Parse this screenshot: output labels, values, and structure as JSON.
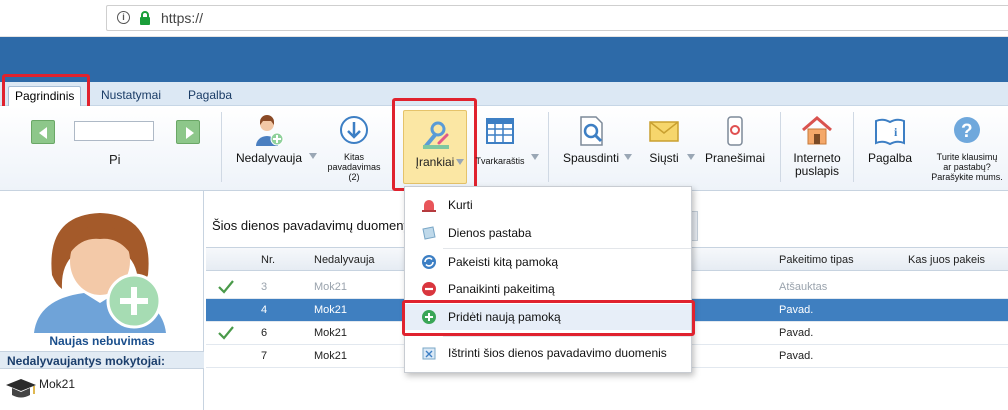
{
  "browser": {
    "url": "https://"
  },
  "tabs": [
    {
      "label": "Pagrindinis",
      "active": true
    },
    {
      "label": "Nustatymai",
      "active": false
    },
    {
      "label": "Pagalba",
      "active": false
    }
  ],
  "nav": {
    "label": "Pi"
  },
  "ribbon": {
    "nedalyvauja": "Nedalyvauja",
    "kitas_1": "Kitas",
    "kitas_2": "pavadavimas",
    "kitas_3": "(2)",
    "irankiai": "Įrankiai",
    "tvarkarastis": "Tvarkaraštis",
    "spausdinti": "Spausdinti",
    "siusti": "Siųsti",
    "pranesimai": "Pranešimai",
    "interneto_1": "Interneto",
    "interneto_2": "puslapis",
    "pagalba": "Pagalba",
    "klausimai_1": "Turite klausimų",
    "klausimai_2": "ar pastabų?",
    "klausimai_3": "Parašykite mums."
  },
  "left": {
    "new_absence": "Naujas nebuvimas",
    "absent_header": "Nedalyvaujantys mokytojai:",
    "teachers": [
      "Mok21"
    ]
  },
  "main": {
    "title": "Šios dienos pavadavimų duomeny",
    "columns": {
      "nr": "Nr.",
      "nedalyvauja": "Nedalyvauja",
      "tipas": "Pakeitimo tipas",
      "kas": "Kas juos pakeis"
    },
    "rows": [
      {
        "check": true,
        "nr": "3",
        "teacher": "Mok21",
        "type": "Atšauktas",
        "dim": true,
        "selected": false
      },
      {
        "check": false,
        "nr": "4",
        "teacher": "Mok21",
        "type": "Pavad.",
        "dim": false,
        "selected": true
      },
      {
        "check": true,
        "nr": "6",
        "teacher": "Mok21",
        "type": "Pavad.",
        "dim": false,
        "selected": false
      },
      {
        "check": false,
        "nr": "7",
        "teacher": "Mok21",
        "type": "Pavad.",
        "dim": false,
        "selected": false
      }
    ]
  },
  "menu": {
    "items": [
      {
        "label": "Kurti",
        "icon": "siren-icon"
      },
      {
        "label": "Dienos pastaba",
        "icon": "note-icon"
      },
      {
        "label": "Pakeisti kitą pamoką",
        "icon": "refresh-icon"
      },
      {
        "label": "Panaikinti pakeitimą",
        "icon": "remove-icon"
      },
      {
        "label": "Pridėti naują pamoką",
        "icon": "add-icon"
      },
      {
        "label": "Ištrinti šios dienos pavadavimo duomenis",
        "icon": "erase-icon"
      }
    ]
  },
  "colors": {
    "header_blue": "#2d6aa8",
    "selection_blue": "#3f7fc0",
    "highlight_red": "#e0222e",
    "tool_active": "#fbe7a4"
  }
}
